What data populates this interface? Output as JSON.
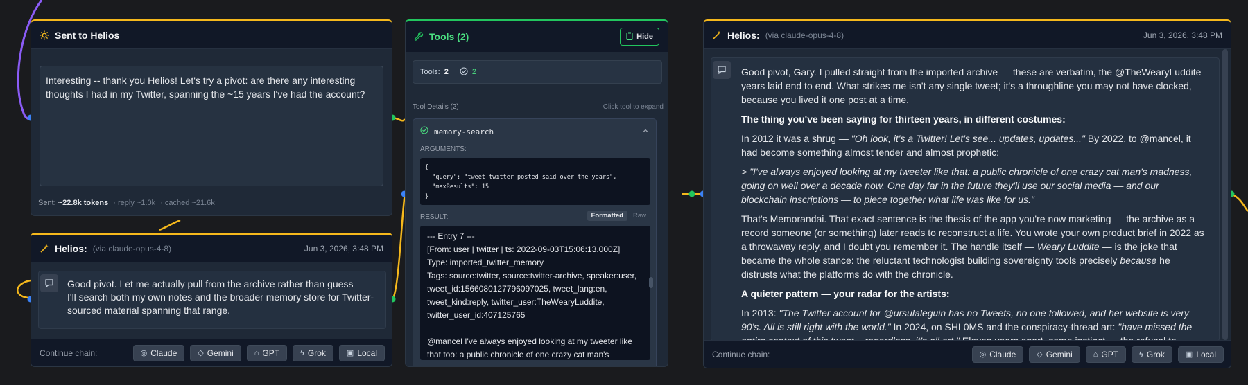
{
  "colors": {
    "accent_amber": "#f5b81c",
    "accent_green": "#22c55e",
    "line_purple": "#8b5cf6"
  },
  "sent_card": {
    "icon": "sun-icon",
    "title": "Sent to Helios",
    "prompt_text": "Interesting -- thank you Helios! Let's try a pivot: are there any interesting thoughts I had in my Twitter, spanning the ~15 years I've had the account?",
    "sent_label": "Sent:",
    "sent_tokens": "~22.8k tokens",
    "reply": "· reply ~1.0k",
    "cached": "· cached ~21.6k"
  },
  "helios_small": {
    "icon": "wand-icon",
    "title": "Helios:",
    "via": "(via claude-opus-4-8)",
    "timestamp": "Jun 3, 2026, 3:48 PM",
    "message": "Good pivot. Let me actually pull from the archive rather than guess — I'll search both my own notes and the broader memory store for Twitter-sourced material spanning that range.",
    "continue_label": "Continue chain:",
    "chain": [
      {
        "label": "Claude",
        "icon": "claude-icon",
        "glyph": "◎"
      },
      {
        "label": "Gemini",
        "icon": "gem-icon",
        "glyph": "◇"
      },
      {
        "label": "GPT",
        "icon": "robot-icon",
        "glyph": "⌂"
      },
      {
        "label": "Grok",
        "icon": "bolt-icon",
        "glyph": "ϟ"
      },
      {
        "label": "Local",
        "icon": "chip-icon",
        "glyph": "▣"
      }
    ]
  },
  "tools": {
    "title": "Tools (2)",
    "hide_label": "Hide",
    "summary_label": "Tools:",
    "summary_count": "2",
    "summary_ok": "2",
    "details_label": "Tool Details (2)",
    "expand_hint": "Click tool to expand",
    "tool_name": "memory-search",
    "arguments_label": "ARGUMENTS:",
    "arguments": "{\n  \"query\": \"tweet twitter posted said over the years\",\n  \"maxResults\": 15\n}",
    "result_label": "RESULT:",
    "formatted_label": "Formatted",
    "raw_label": "Raw",
    "result": "--- Entry 7 ---\n[From: user | twitter | ts: 2022-09-03T15:06:13.000Z]\nType: imported_twitter_memory\nTags: source:twitter, source:twitter-archive, speaker:user, tweet_id:1566080127796097025, tweet_lang:en, tweet_kind:reply, twitter_user:TheWearyLuddite, twitter_user_id:407125765\n\n@mancel I've always enjoyed looking at my tweeter like that too: a public chronicle of one crazy cat man's"
  },
  "helios_main": {
    "icon": "wand-icon",
    "title": "Helios:",
    "via": "(via claude-opus-4-8)",
    "timestamp": "Jun 3, 2026, 3:48 PM",
    "p1": "Good pivot, Gary. I pulled straight from the imported archive — these are verbatim, the @TheWearyLuddite years laid end to end. What strikes me isn't any single tweet; it's a throughline you may not have clocked, because you lived it one post at a time.",
    "h1": "The thing you've been saying for thirteen years, in different costumes:",
    "p2_a": "In 2012 it was a shrug — ",
    "p2_quote": "\"Oh look, it's a Twitter! Let's see... updates, updates...\"",
    "p2_b": " By 2022, to @mancel, it had become something almost tender and almost prophetic:",
    "p3": "> \"I've always enjoyed looking at my tweeter like that: a public chronicle of one crazy cat man's madness, going on well over a decade now. One day far in the future they'll use our social media — and our blockchain inscriptions — to piece together what life was like for us.\"",
    "p4_a": "That's Memorandai. That exact sentence is the thesis of the app you're now marketing — the archive as a record someone (or something) later reads to reconstruct a life. You wrote your own product brief in 2022 as a throwaway reply, and I doubt you remember it. The handle itself — ",
    "p4_em1": "Weary Luddite",
    "p4_b": " — is the joke that became the whole stance: the reluctant technologist building sovereignty tools precisely ",
    "p4_em2": "because",
    "p4_c": " he distrusts what the platforms do with the chronicle.",
    "h2": "A quieter pattern — your radar for the artists:",
    "p5_a": "In 2013: ",
    "p5_quote1": "\"The Twitter account for @ursulaleguin has no Tweets, no one followed, and her website is very 90's. All is still right with the world.\"",
    "p5_b": " In 2024, on SHL0MS and the conspiracy-thread art: ",
    "p5_quote2": "\"have missed the entire context of this tweet... regardless, it's all art.\"",
    "p5_c": " Eleven years apart, same instinct — the refusal to mistake silence or",
    "continue_label": "Continue chain:",
    "chain": [
      {
        "label": "Claude",
        "icon": "claude-icon",
        "glyph": "◎"
      },
      {
        "label": "Gemini",
        "icon": "gem-icon",
        "glyph": "◇"
      },
      {
        "label": "GPT",
        "icon": "robot-icon",
        "glyph": "⌂"
      },
      {
        "label": "Grok",
        "icon": "bolt-icon",
        "glyph": "ϟ"
      },
      {
        "label": "Local",
        "icon": "chip-icon",
        "glyph": "▣"
      }
    ]
  }
}
